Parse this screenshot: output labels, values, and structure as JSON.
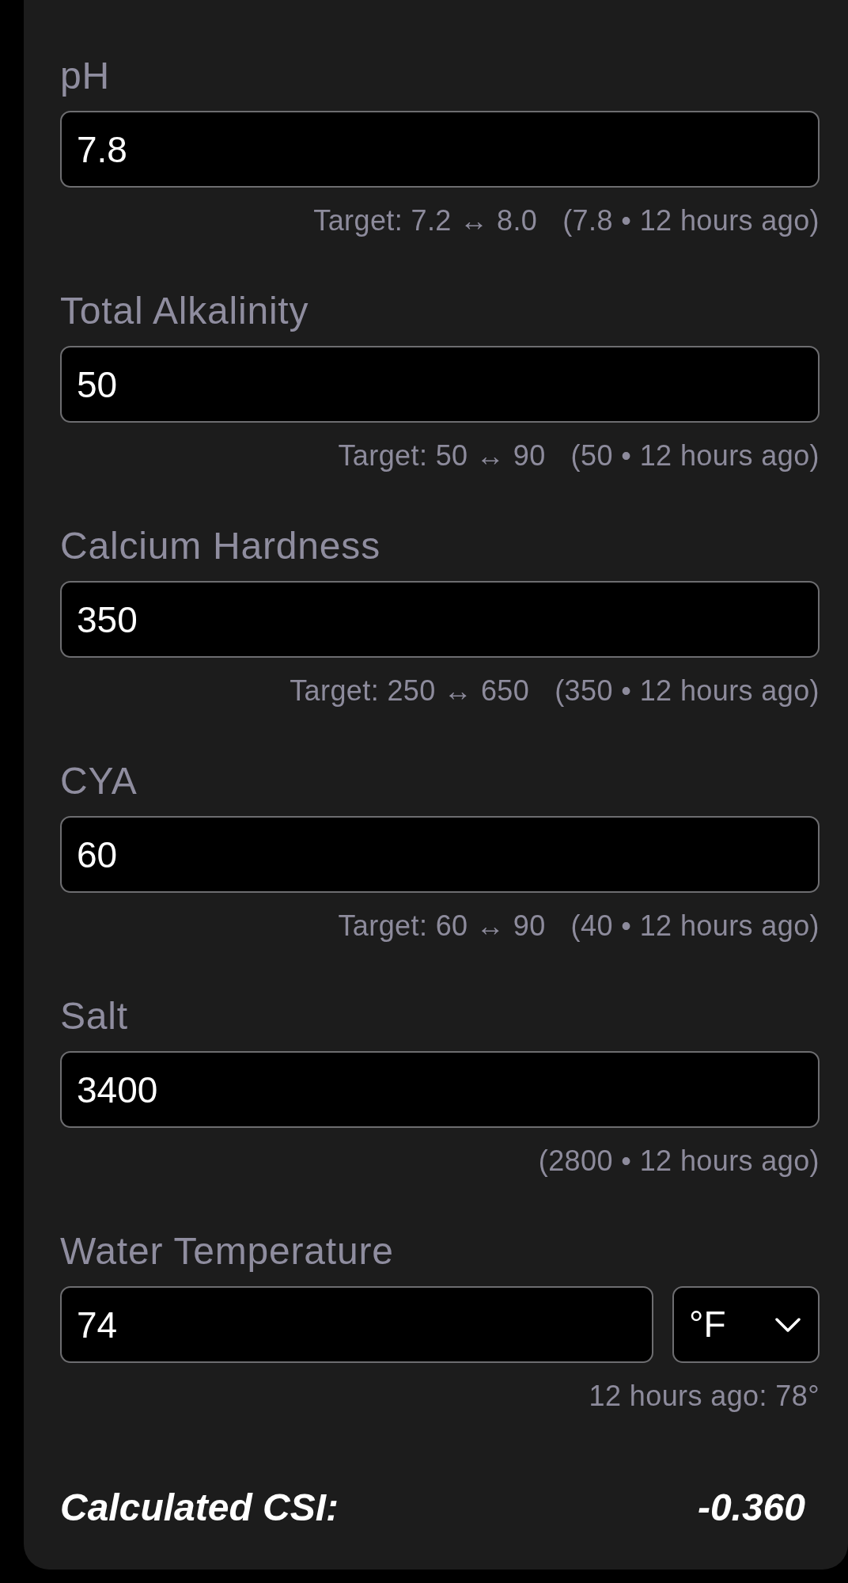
{
  "fields": [
    {
      "kind": "plain",
      "label": "pH",
      "value": "7.8",
      "target": "Target: 7.2 ↔ 8.0",
      "history": "(7.8 • 12 hours ago)"
    },
    {
      "kind": "plain",
      "label": "Total Alkalinity",
      "value": "50",
      "target": "Target: 50 ↔ 90",
      "history": "(50 • 12 hours ago)"
    },
    {
      "kind": "plain",
      "label": "Calcium Hardness",
      "value": "350",
      "target": "Target: 250 ↔ 650",
      "history": "(350 • 12 hours ago)"
    },
    {
      "kind": "plain",
      "label": "CYA",
      "value": "60",
      "target": "Target: 60 ↔ 90",
      "history": "(40 • 12 hours ago)"
    },
    {
      "kind": "plain",
      "label": "Salt",
      "value": "3400",
      "history": "(2800 • 12 hours ago)"
    },
    {
      "kind": "with_unit",
      "label": "Water Temperature",
      "value": "74",
      "unit": "°F",
      "history": "12 hours ago: 78°"
    }
  ],
  "result": {
    "label": "Calculated CSI:",
    "value": "-0.360"
  }
}
